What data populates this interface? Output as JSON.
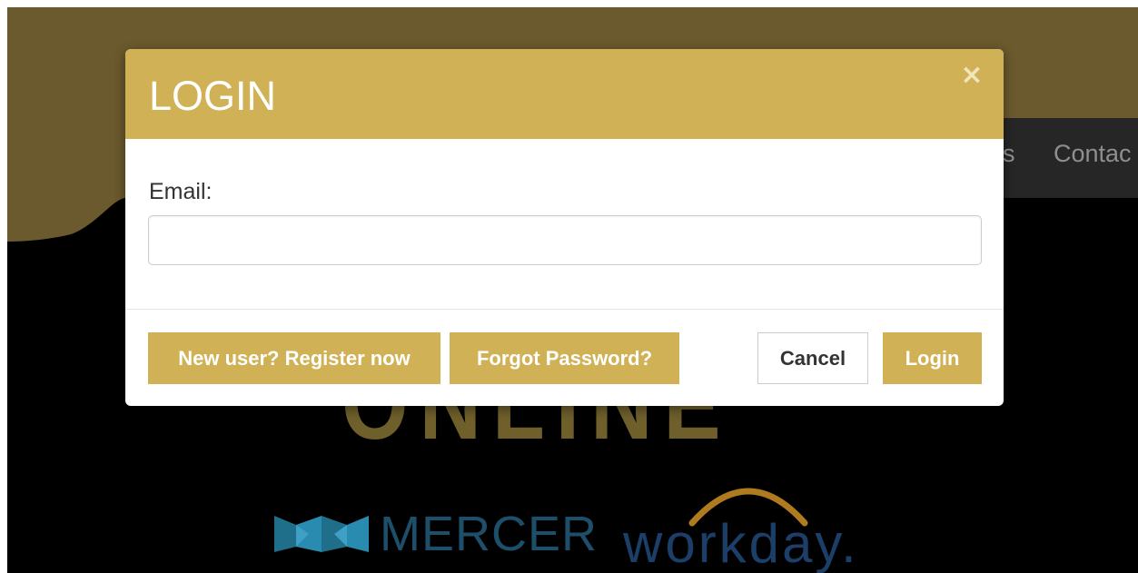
{
  "background": {
    "nav_items": [
      "s",
      "Contac"
    ],
    "hero_text": "ONLINE",
    "logos": {
      "mercer": "MERCER",
      "workday": "workday."
    }
  },
  "modal": {
    "title": "LOGIN",
    "close_icon": "×",
    "email_label": "Email:",
    "email_value": "",
    "email_placeholder": "",
    "buttons": {
      "register": "New user? Register now",
      "forgot": "Forgot Password?",
      "cancel": "Cancel",
      "login": "Login"
    }
  },
  "colors": {
    "accent_gold": "#d1b156",
    "header_brown": "#6b5a2d",
    "nav_dark": "#262626",
    "mercer_blue": "#1d4f6b",
    "workday_blue": "#1c3f69",
    "workday_orange": "#b07a1e"
  }
}
